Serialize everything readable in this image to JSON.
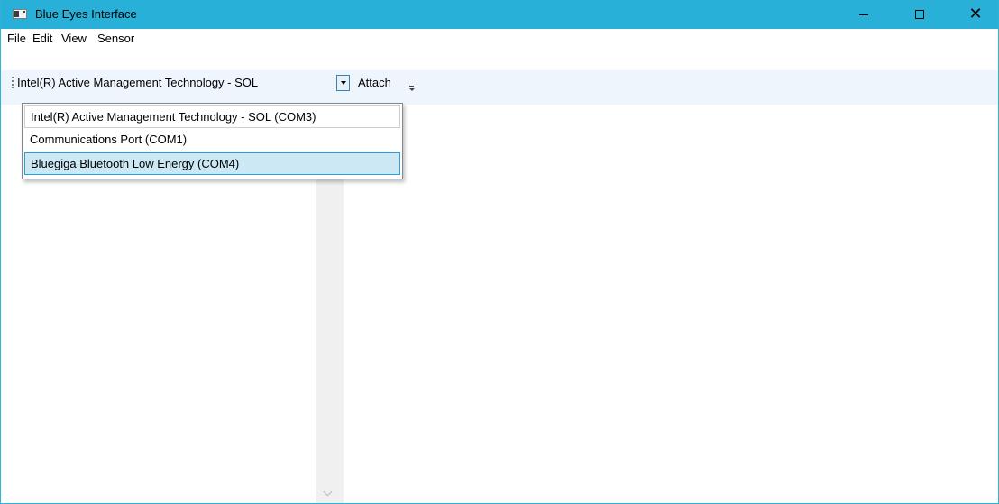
{
  "window": {
    "title": "Blue Eyes Interface",
    "accent_color": "#29b0d8",
    "controls": {
      "minimize_icon": "minimize-icon",
      "maximize_icon": "maximize-icon",
      "close_glyph": "✕"
    }
  },
  "menubar": {
    "items": [
      "File",
      "Edit",
      "View",
      "Sensor"
    ]
  },
  "toolbar": {
    "port_select": {
      "selected_value": "Intel(R) Active Management Technology - SOL",
      "options": [
        "Intel(R) Active Management Technology - SOL (COM3)",
        "Communications Port (COM1)",
        "Bluegiga Bluetooth Low Energy (COM4)"
      ],
      "highlighted_option": "Bluegiga Bluetooth Low Energy (COM4)"
    },
    "attach_label": "Attach"
  }
}
